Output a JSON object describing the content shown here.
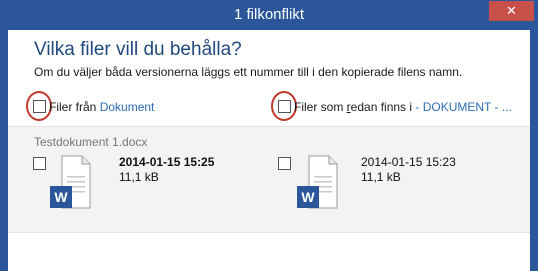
{
  "window": {
    "title": "1 filkonflikt",
    "close_glyph": "✕"
  },
  "dialog": {
    "heading": "Vilka filer vill du behålla?",
    "subheading": "Om du väljer båda versionerna läggs ett nummer till i den kopierade filens namn.",
    "source_option": {
      "prefix": "Filer från ",
      "link": "Dokument",
      "checked": false
    },
    "dest_option": {
      "prefix_a": "Filer som ",
      "prefix_underlined": "r",
      "prefix_b": "edan finns i ",
      "link": "- DOKUMENT - ...",
      "checked": false
    }
  },
  "conflict": {
    "filename": "Testdokument 1.docx",
    "source": {
      "date": "2014-01-15 15:25",
      "size": "11,1 kB",
      "icon": "word-document-icon",
      "checked": false
    },
    "dest": {
      "date": "2014-01-15 15:23",
      "size": "11,1 kB",
      "icon": "word-document-icon",
      "checked": false
    }
  },
  "colors": {
    "accent": "#2b579a",
    "close": "#c7504b",
    "heading": "#1f497d",
    "link": "#2b6cb0",
    "highlight": "#c0392b"
  }
}
